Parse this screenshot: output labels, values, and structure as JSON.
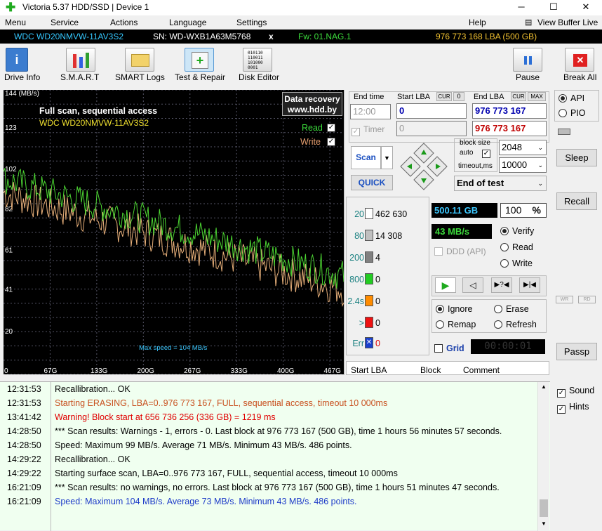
{
  "window": {
    "title": "Victoria 5.37 HDD/SSD | Device 1",
    "min": "─",
    "max": "☐",
    "close": "✕"
  },
  "menu": {
    "items": [
      "Menu",
      "Service",
      "Actions",
      "Language",
      "Settings",
      "Help"
    ],
    "view_buffer": "View Buffer Live"
  },
  "info": {
    "model": "WDC WD20NMVW-11AV3S2",
    "serial": "SN: WD-WXB1A63M5768",
    "x": "x",
    "fw": "Fw: 01.NAG.1",
    "lba": "976 773 168 LBA (500 GB)"
  },
  "toolbar": {
    "drive_info": "Drive Info",
    "smart": "S.M.A.R.T",
    "smart_logs": "SMART Logs",
    "test_repair": "Test & Repair",
    "disk_editor": "Disk Editor",
    "pause": "Pause",
    "break_all": "Break All"
  },
  "graph": {
    "units": "144 (MB/s)",
    "title": "Full scan, sequential access",
    "model": "WDC WD20NMVW-11AV3S2",
    "badge1": "Data recovery",
    "badge2": "www.hdd.by",
    "read": "Read",
    "write": "Write",
    "max_speed": "Max speed = 104 MB/s",
    "y_ticks": [
      "123",
      "102",
      "82",
      "61",
      "41",
      "20"
    ],
    "x_ticks": [
      "0",
      "67G",
      "133G",
      "200G",
      "267G",
      "333G",
      "400G",
      "467G"
    ],
    "read_color": "#4cd632",
    "write_color": "#e8b07a"
  },
  "chart_data": {
    "type": "line",
    "title": "Full scan, sequential access",
    "ylabel": "MB/s",
    "ylim": [
      0,
      144
    ],
    "xlim": [
      0,
      500
    ],
    "series": [
      {
        "name": "Read",
        "start": 99,
        "end": 50
      },
      {
        "name": "Write",
        "start": 92,
        "end": 43
      }
    ]
  },
  "controls": {
    "end_time": "End time",
    "start_lba": "Start LBA",
    "cur": "CUR",
    "zero": "0",
    "end_lba": "End LBA",
    "max": "MAX",
    "time_value": "12:00",
    "start_value": "0",
    "end_value": "976 773 167",
    "timer": "Timer",
    "timer_value": "0",
    "end_value2": "976 773 167",
    "scan": "Scan",
    "quick": "QUICK",
    "block_size": "block size",
    "auto": "auto",
    "timeout": "timeout,ms",
    "block_value": "2048",
    "timeout_value": "10000",
    "end_of_test": "End of test"
  },
  "stats": {
    "rows": [
      {
        "label": "20",
        "count": "462 630",
        "color": "#ffffff"
      },
      {
        "label": "80",
        "count": "14 308",
        "color": "#c0c0c0"
      },
      {
        "label": "200",
        "count": "4",
        "color": "#808080"
      },
      {
        "label": "800",
        "count": "0",
        "color": "#22cc22"
      },
      {
        "label": "2.4s",
        "count": "0",
        "color": "#ff8c00"
      },
      {
        "label": ">",
        "count": "0",
        "color": "#ee1111"
      },
      {
        "label": "Err",
        "count": "0",
        "color": "#1a3fcc"
      }
    ],
    "gb": "500.11 GB",
    "pct": "100",
    "pct_sign": "%",
    "speed": "43 MB/s",
    "ddd": "DDD (API)",
    "verify": "Verify",
    "read": "Read",
    "write": "Write",
    "ignore": "Ignore",
    "erase": "Erase",
    "remap": "Remap",
    "refresh": "Refresh",
    "grid": "Grid",
    "timer": "00:00:01"
  },
  "table": {
    "start_lba": "Start LBA",
    "block": "Block",
    "comment": "Comment"
  },
  "side": {
    "api": "API",
    "pio": "PIO",
    "sleep": "Sleep",
    "recall": "Recall",
    "wr": "WR",
    "rd": "RD",
    "passp": "Passp",
    "sound": "Sound",
    "hints": "Hints"
  },
  "log": [
    {
      "time": "12:31:53",
      "msg": "Recallibration... OK",
      "color": "#000000"
    },
    {
      "time": "12:31:53",
      "msg": "Starting ERASING, LBA=0..976 773 167, FULL, sequential access, timeout 10 000ms",
      "color": "#c8501e"
    },
    {
      "time": "13:41:42",
      "msg": "Warning! Block start at 656 736 256 (336 GB)  = 1219 ms",
      "color": "#e00000"
    },
    {
      "time": "14:28:50",
      "msg": "*** Scan results: Warnings - 1, errors - 0. Last block at 976 773 167 (500 GB), time 1 hours 56 minutes 57 seconds.",
      "color": "#000000"
    },
    {
      "time": "14:28:50",
      "msg": "Speed: Maximum 99 MB/s. Average 71 MB/s. Minimum 43 MB/s. 486 points.",
      "color": "#000000"
    },
    {
      "time": "14:29:22",
      "msg": "Recallibration... OK",
      "color": "#000000"
    },
    {
      "time": "14:29:22",
      "msg": "Starting surface scan, LBA=0..976 773 167, FULL, sequential access, timeout 10 000ms",
      "color": "#000000"
    },
    {
      "time": "16:21:09",
      "msg": "*** Scan results: no warnings, no errors. Last block at 976 773 167 (500 GB), time 1 hours 51 minutes 47 seconds.",
      "color": "#000000"
    },
    {
      "time": "16:21:09",
      "msg": "Speed: Maximum 104 MB/s. Average 73 MB/s. Minimum 43 MB/s. 486 points.",
      "color": "#1e3cc8"
    }
  ]
}
